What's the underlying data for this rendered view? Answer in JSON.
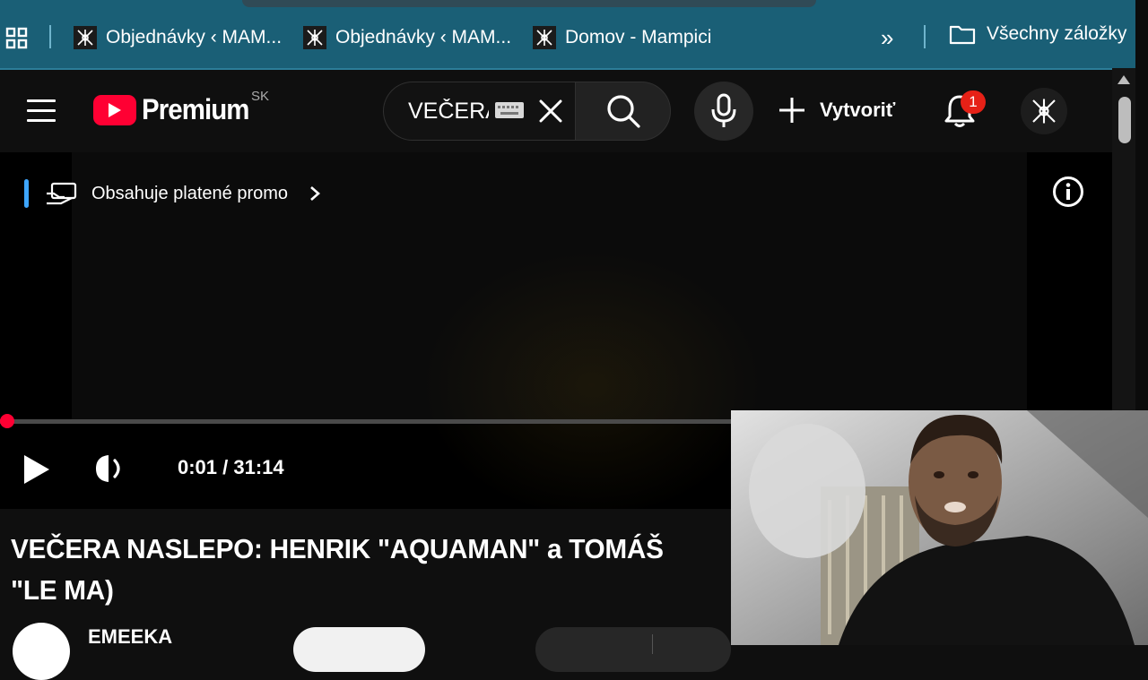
{
  "bookmarks": {
    "items": [
      {
        "label": "Objednávky ‹ MAM..."
      },
      {
        "label": "Objednávky ‹ MAM..."
      },
      {
        "label": "Domov - Mampici"
      }
    ],
    "more_label": "»",
    "folder_label": "Všechny záložky"
  },
  "header": {
    "logo_text": "Premium",
    "region": "SK",
    "search": {
      "value": "VEČERA NASLEPO"
    },
    "create_label": "Vytvoriť",
    "notification_count": "1"
  },
  "player": {
    "promo_label": "Obsahuje platené promo",
    "time": "0:01 / 31:14",
    "progress": 0.001
  },
  "video": {
    "title": "VEČERA NASLEPO: HENRIK \"AQUAMAN\" a TOMÁŠ \"LE MA)",
    "channel": "EMEEKA"
  },
  "colors": {
    "bookmark_bar": "#1a5f76",
    "brand_red": "#ff0033",
    "background": "#0f0f0f",
    "promo_accent": "#3ea6ff"
  },
  "icons": {
    "apps": "grid-icon",
    "favicon": "mampici-logo-icon",
    "folder": "folder-icon",
    "menu": "hamburger-icon",
    "search": "search-icon",
    "mic": "mic-icon",
    "create": "plus-icon",
    "bell": "bell-icon",
    "info": "info-icon",
    "play": "play-icon",
    "volume": "volume-icon"
  }
}
